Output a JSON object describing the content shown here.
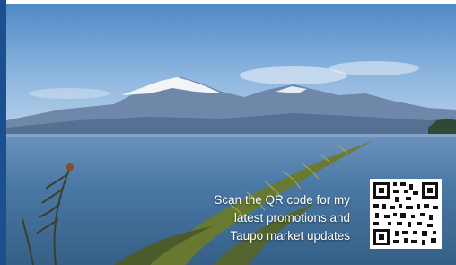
{
  "promo": {
    "caption_lines": [
      "Scan the QR code for my",
      "latest promotions and",
      "Taupo market updates"
    ],
    "qr_icon": "qr-code-icon"
  },
  "colors": {
    "accent_strip": "#1c4f8f",
    "sky": "#5d95cf",
    "lake": "#3f6f9a"
  }
}
